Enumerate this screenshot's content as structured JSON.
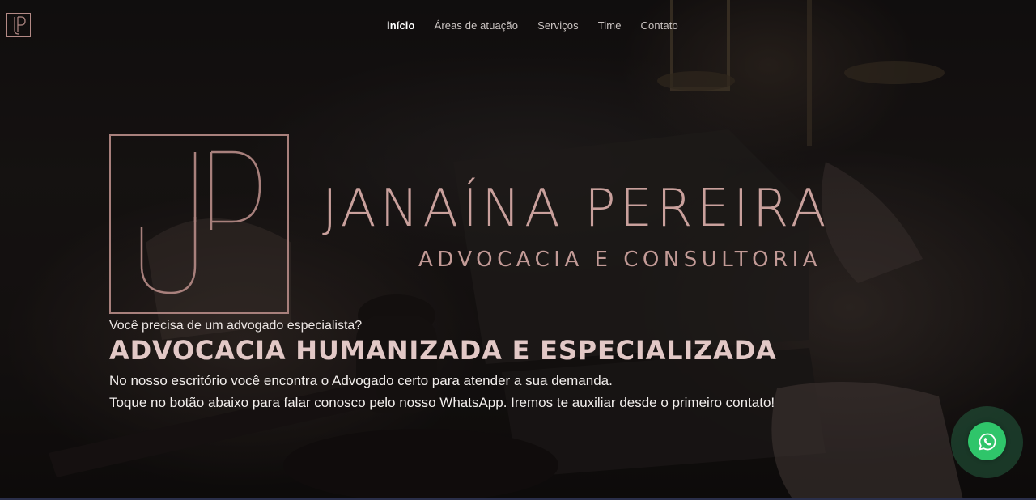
{
  "corner_logo": {
    "icon": "jp-monogram-icon"
  },
  "nav": {
    "items": [
      {
        "label": "início",
        "active": true
      },
      {
        "label": "Áreas de atuação",
        "active": false
      },
      {
        "label": "Serviços",
        "active": false
      },
      {
        "label": "Time",
        "active": false
      },
      {
        "label": "Contato",
        "active": false
      }
    ]
  },
  "brand": {
    "monogram_icon": "jp-monogram-icon",
    "name": "JANAÍNA PEREIRA",
    "tagline": "ADVOCACIA E CONSULTORIA"
  },
  "hero": {
    "question": "Você precisa de um advogado especialista?",
    "title": "ADVOCACIA HUMANIZADA E ESPECIALIZADA",
    "line1": "No nosso escritório você encontra o Advogado certo para atender a sua demanda.",
    "line2": "Toque no botão abaixo para falar conosco pelo nosso WhatsApp. Iremos te auxiliar desde o primeiro contato!"
  },
  "whatsapp": {
    "icon": "whatsapp-icon"
  },
  "colors": {
    "accent_rose": "#c9a09c",
    "whatsapp_green": "#2fc56a"
  }
}
